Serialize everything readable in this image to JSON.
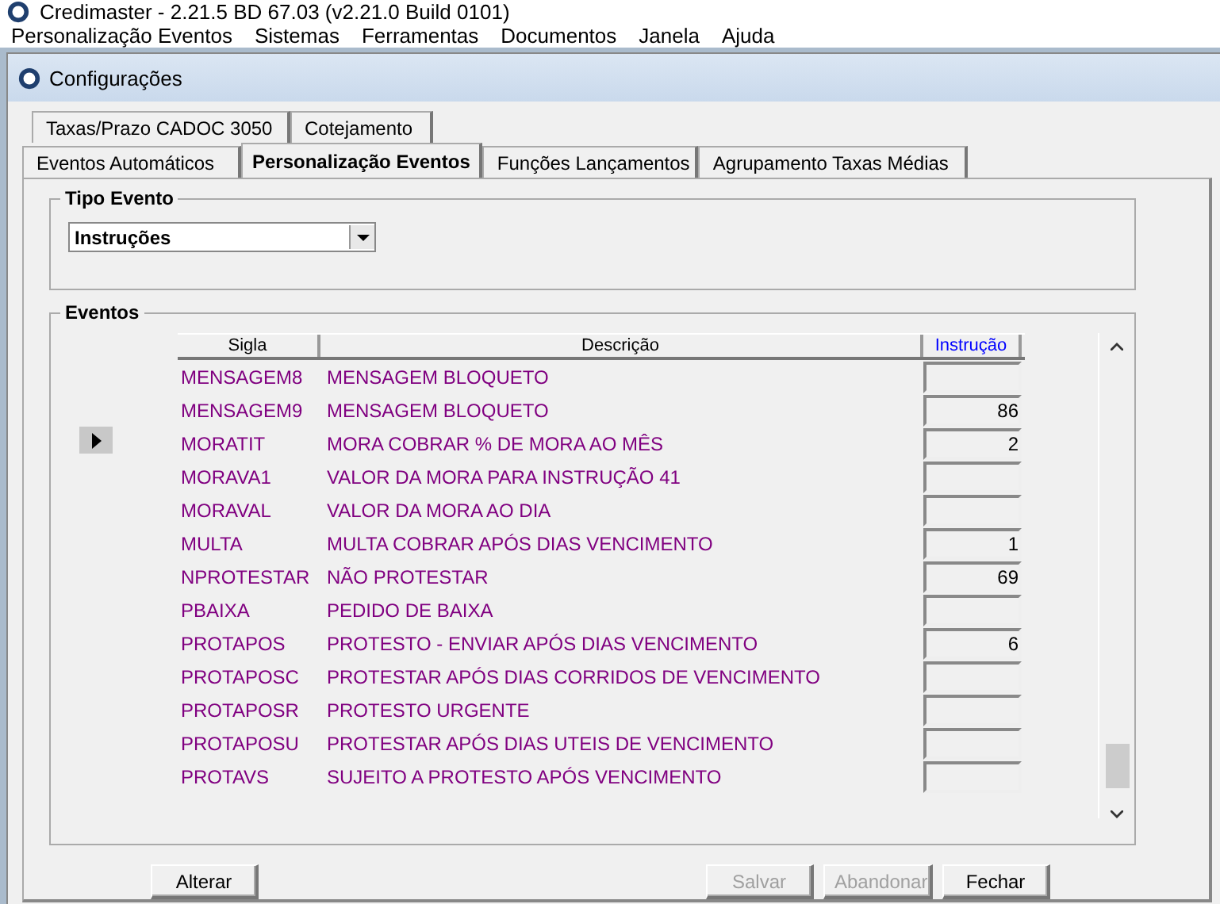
{
  "app_window": {
    "title": "Credimaster - 2.21.5 BD 67.03 (v2.21.0 Build 0101)"
  },
  "menu_bar": [
    "Personalização Eventos",
    "Sistemas",
    "Ferramentas",
    "Documentos",
    "Janela",
    "Ajuda"
  ],
  "child_window": {
    "title": "Configurações"
  },
  "tabs_row_1": [
    {
      "label": "Taxas/Prazo CADOC 3050",
      "selected": false
    },
    {
      "label": "Cotejamento",
      "selected": false
    }
  ],
  "tabs_row_2": [
    {
      "label": "Eventos Automáticos",
      "selected": false
    },
    {
      "label": "Personalização Eventos",
      "selected": true
    },
    {
      "label": "Funções Lançamentos",
      "selected": false
    },
    {
      "label": "Agrupamento Taxas Médias",
      "selected": false
    }
  ],
  "tipo_evento": {
    "label": "Tipo Evento",
    "value": "Instruções"
  },
  "eventos": {
    "label": "Eventos",
    "columns": [
      "Sigla",
      "Descrição",
      "Instrução"
    ],
    "rows": [
      {
        "sigla": "MENSAGEM8",
        "descricao": "MENSAGEM BLOQUETO",
        "instrucao": "",
        "selected": false
      },
      {
        "sigla": "MENSAGEM9",
        "descricao": "MENSAGEM BLOQUETO",
        "instrucao": "86",
        "selected": false
      },
      {
        "sigla": "MORATIT",
        "descricao": "MORA COBRAR % DE MORA AO MÊS",
        "instrucao": "2",
        "selected": true
      },
      {
        "sigla": "MORAVA1",
        "descricao": "VALOR DA MORA PARA INSTRUÇÃO 41",
        "instrucao": "",
        "selected": false
      },
      {
        "sigla": "MORAVAL",
        "descricao": "VALOR DA MORA AO DIA",
        "instrucao": "",
        "selected": false
      },
      {
        "sigla": "MULTA",
        "descricao": "MULTA COBRAR APÓS DIAS VENCIMENTO",
        "instrucao": "1",
        "selected": false
      },
      {
        "sigla": "NPROTESTAR",
        "descricao": "NÃO PROTESTAR",
        "instrucao": "69",
        "selected": false
      },
      {
        "sigla": "PBAIXA",
        "descricao": "PEDIDO DE BAIXA",
        "instrucao": "",
        "selected": false
      },
      {
        "sigla": "PROTAPOS",
        "descricao": "PROTESTO - ENVIAR APÓS DIAS VENCIMENTO",
        "instrucao": "6",
        "selected": false
      },
      {
        "sigla": "PROTAPOSC",
        "descricao": "PROTESTAR APÓS DIAS CORRIDOS DE VENCIMENTO",
        "instrucao": "",
        "selected": false
      },
      {
        "sigla": "PROTAPOSR",
        "descricao": "PROTESTO URGENTE",
        "instrucao": "",
        "selected": false
      },
      {
        "sigla": "PROTAPOSU",
        "descricao": "PROTESTAR APÓS DIAS UTEIS DE VENCIMENTO",
        "instrucao": "",
        "selected": false
      },
      {
        "sigla": "PROTAVS",
        "descricao": "SUJEITO A PROTESTO APÓS VENCIMENTO",
        "instrucao": "",
        "selected": false
      }
    ]
  },
  "buttons": [
    {
      "label": "Alterar",
      "disabled": false
    },
    {
      "label": "Salvar",
      "disabled": true
    },
    {
      "label": "Abandonar",
      "disabled": true
    },
    {
      "label": "Fechar",
      "disabled": false
    }
  ]
}
